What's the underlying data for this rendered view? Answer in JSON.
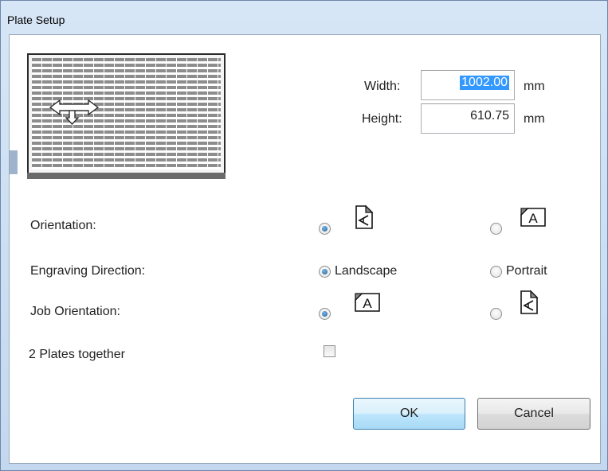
{
  "window": {
    "title": "Plate Setup"
  },
  "size": {
    "width_label": "Width:",
    "width_value": "1002.00",
    "height_label": "Height:",
    "height_value": "610.75",
    "unit": "mm"
  },
  "orientation": {
    "label": "Orientation:"
  },
  "engraving": {
    "label": "Engraving Direction:",
    "option1": "Landscape",
    "option2": "Portrait"
  },
  "job": {
    "label": "Job Orientation:"
  },
  "plates": {
    "label": "2 Plates together"
  },
  "buttons": {
    "ok": "OK",
    "cancel": "Cancel"
  }
}
